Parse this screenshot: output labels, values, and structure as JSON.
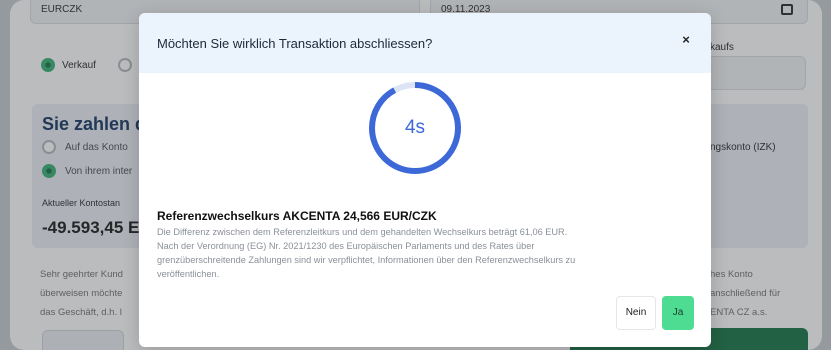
{
  "background": {
    "currency_pair_value": "EURCZK",
    "date_value": "09.11.2023",
    "radio_sell_label": "Verkauf",
    "right_col_label": "kaufs",
    "pay_heading": "Sie zahlen d",
    "pay_option_account": "Auf das Konto",
    "pay_option_from": "Von ihrem inter",
    "right_account_label": "ngskonto (IZK)",
    "current_balance_label": "Aktueller Kontostan",
    "current_balance_value": "-49.593,45 EU",
    "note_left_lines": [
      "Sehr geehrter Kund",
      "überweisen möchte",
      "das Geschäft, d.h. l"
    ],
    "note_right_lines": [
      "hes Konto",
      "anschließend für",
      "ENTA CZ a.s."
    ]
  },
  "modal": {
    "title": "Möchten Sie wirklich Transaktion abschliessen?",
    "close_label": "×",
    "countdown_text": "4s",
    "countdown_progress": 0.92,
    "rate_title": "Referenzwechselkurs AKCENTA 24,566 EUR/CZK",
    "rate_desc_lines": [
      "Die Differenz zwischen dem Referenzleitkurs und dem gehandelten Wechselkurs beträgt 61,06 EUR.",
      "Nach der Verordnung (EG) Nr. 2021/1230 des Europäischen Parlaments und des Rates über",
      "grenzüberschreitende Zahlungen sind wir verpflichtet, Informationen über den Referenzwechselkurs zu",
      "veröffentlichen."
    ],
    "no_label": "Nein",
    "yes_label": "Ja"
  },
  "colors": {
    "ring_active": "#3d68d8",
    "ring_track": "#dde4f6",
    "yes_button": "#4ddc92",
    "header_bg": "#ebf3fc"
  }
}
